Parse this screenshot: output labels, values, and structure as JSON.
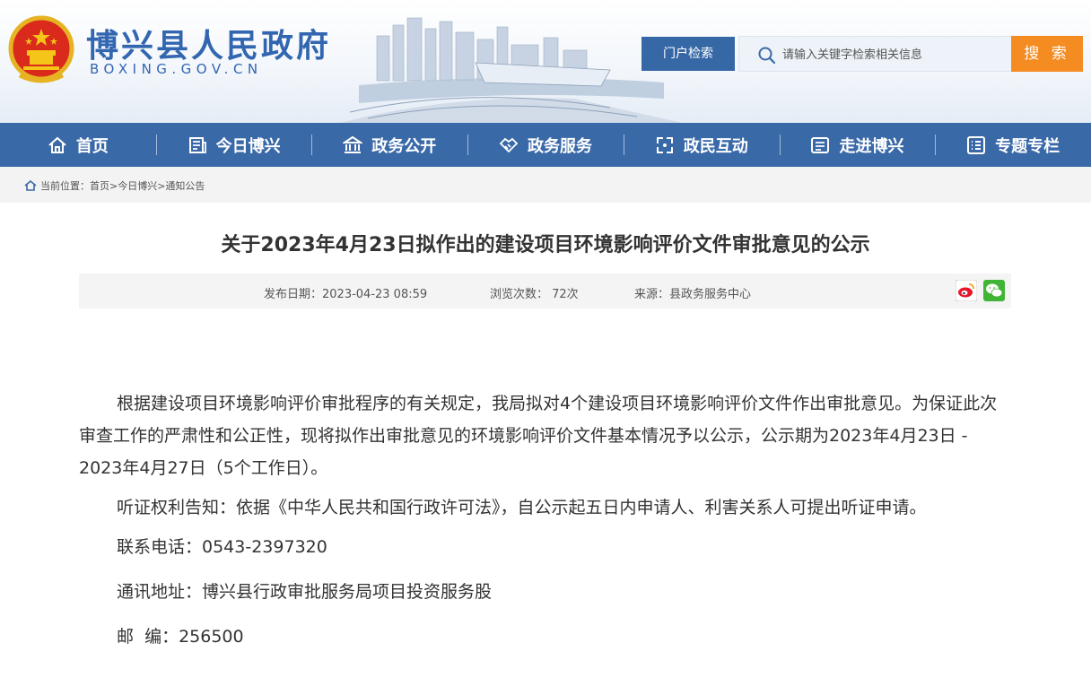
{
  "header": {
    "site_title": "博兴县人民政府",
    "site_domain": "BOXING.GOV.CN",
    "search_label": "门户检索",
    "search_placeholder": "请输入关键字检索相关信息",
    "search_button": "搜 索"
  },
  "nav": {
    "items": [
      {
        "label": "首页",
        "icon": "home-icon"
      },
      {
        "label": "今日博兴",
        "icon": "newspaper-icon"
      },
      {
        "label": "政务公开",
        "icon": "government-building-icon"
      },
      {
        "label": "政务服务",
        "icon": "handshake-icon"
      },
      {
        "label": "政民互动",
        "icon": "interaction-icon"
      },
      {
        "label": "走进博兴",
        "icon": "id-card-icon"
      },
      {
        "label": "专题专栏",
        "icon": "list-icon"
      }
    ]
  },
  "breadcrumb": {
    "prefix": "当前位置：",
    "path": "首页>今日博兴>通知公告"
  },
  "article": {
    "title": "关于2023年4月23日拟作出的建设项目环境影响评价文件审批意见的公示",
    "publish_date": "发布日期：2023-04-23 08:59",
    "views": "浏览次数： 72次",
    "source": "来源：县政务服务中心",
    "paragraphs": [
      "根据建设项目环境影响评价审批程序的有关规定，我局拟对4个建设项目环境影响评价文件作出审批意见。为保证此次审查工作的严肃性和公正性，现将拟作出审批意见的环境影响评价文件基本情况予以公示，公示期为2023年4月23日 - 2023年4月27日（5个工作日）。",
      "听证权利告知：依据《中华人民共和国行政许可法》，自公示起五日内申请人、利害关系人可提出听证申请。",
      "联系电话：0543-2397320",
      "通讯地址：博兴县行政审批服务局项目投资服务股",
      "邮  编：256500"
    ]
  },
  "colors": {
    "brand_blue": "#3a69a8",
    "accent_orange": "#f48c22"
  }
}
